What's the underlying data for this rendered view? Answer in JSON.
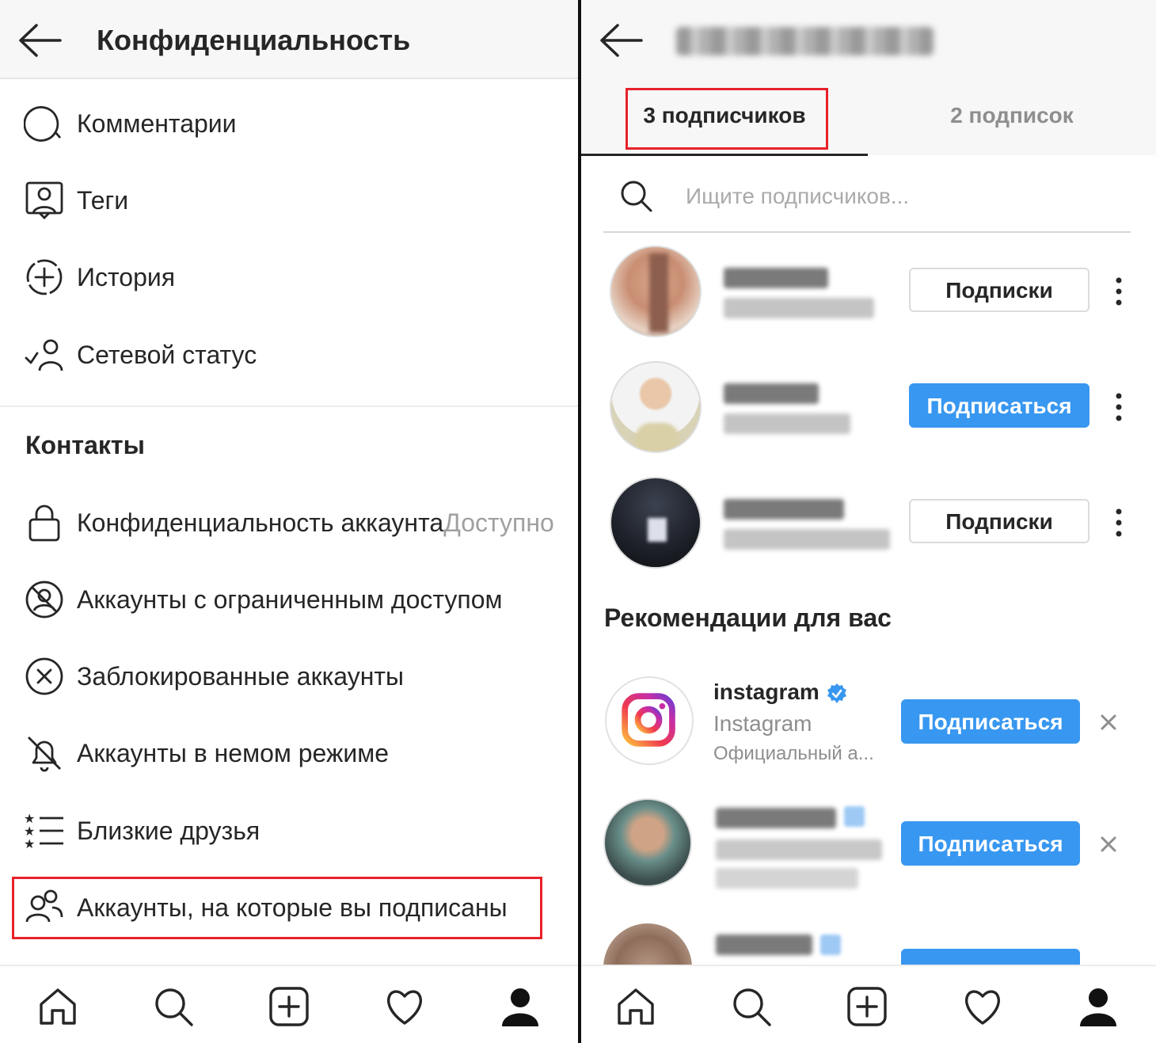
{
  "left": {
    "title": "Конфиденциальность",
    "items": [
      {
        "label": "Комментарии",
        "icon": "comment-icon"
      },
      {
        "label": "Теги",
        "icon": "tag-person-icon"
      },
      {
        "label": "История",
        "icon": "story-add-icon"
      },
      {
        "label": "Сетевой статус",
        "icon": "activity-status-icon"
      }
    ],
    "section_contacts": "Контакты",
    "contacts": [
      {
        "label": "Конфиденциальность аккаунта",
        "sub": "Доступно",
        "icon": "lock-icon"
      },
      {
        "label": "Аккаунты с ограниченным доступом",
        "icon": "restricted-icon"
      },
      {
        "label": "Заблокированные аккаунты",
        "icon": "blocked-icon"
      },
      {
        "label": "Аккаунты в немом режиме",
        "icon": "muted-bell-icon"
      },
      {
        "label": "Близкие друзья",
        "icon": "close-friends-icon"
      },
      {
        "label": "Аккаунты, на которые вы подписаны",
        "icon": "people-icon"
      }
    ]
  },
  "right": {
    "tabs": [
      {
        "label": "3 подписчиков",
        "active": true
      },
      {
        "label": "2 подписок",
        "active": false
      }
    ],
    "search": {
      "placeholder": "Ищите подписчиков..."
    },
    "followers": [
      {
        "button": "Подписки",
        "style": "outline"
      },
      {
        "button": "Подписаться",
        "style": "blue"
      },
      {
        "button": "Подписки",
        "style": "outline"
      }
    ],
    "reco_title": "Рекомендации для вас",
    "suggestions": [
      {
        "username": "instagram",
        "name": "Instagram",
        "desc": "Официальный а...",
        "button": "Подписаться",
        "verified": true
      },
      {
        "button": "Подписаться"
      }
    ]
  },
  "nav": [
    "home-icon",
    "search-icon",
    "add-post-icon",
    "heart-icon",
    "profile-icon"
  ],
  "colors": {
    "accent": "#3897f0",
    "highlight": "#e8212a",
    "text": "#262626",
    "muted": "#a0a0a0"
  }
}
